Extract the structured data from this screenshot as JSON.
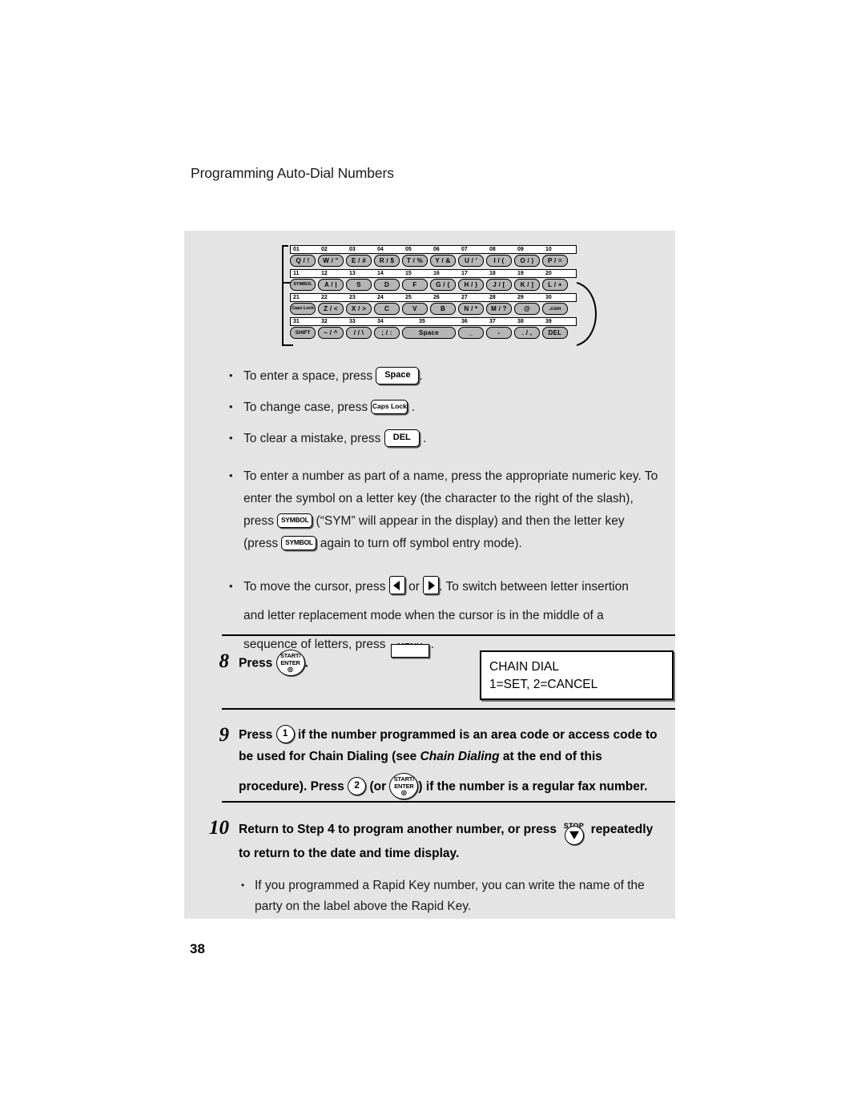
{
  "page": {
    "running_head": "Programming Auto-Dial Numbers",
    "page_number": "38"
  },
  "keyboard_figure": {
    "rows": [
      {
        "numbers": [
          "01",
          "02",
          "03",
          "04",
          "05",
          "06",
          "07",
          "08",
          "09",
          "10"
        ],
        "keys": [
          "Q / !",
          "W / \"",
          "E / #",
          "R / $",
          "T / %",
          "Y / &",
          "U / '",
          "I / (",
          "O / )",
          "P / ="
        ]
      },
      {
        "numbers": [
          "11",
          "12",
          "13",
          "14",
          "15",
          "16",
          "17",
          "18",
          "19",
          "20"
        ],
        "keys": [
          "SYMBOL",
          "A / |",
          "S",
          "D",
          "F",
          "G / {",
          "H / }",
          "J / [",
          "K / ]",
          "L / +"
        ]
      },
      {
        "numbers": [
          "21",
          "22",
          "23",
          "24",
          "25",
          "26",
          "27",
          "28",
          "29",
          "30"
        ],
        "keys": [
          "Caps Lock",
          "Z / <",
          "X / >",
          "C",
          "V",
          "B",
          "N / *",
          "M / ?",
          "@",
          ".com"
        ]
      },
      {
        "numbers": [
          "31",
          "32",
          "33",
          "34",
          "35",
          "36",
          "37",
          "38",
          "39"
        ],
        "keys": [
          "SHIFT",
          "~ / ^",
          "/ / \\",
          "; / :",
          "Space",
          "_",
          "-",
          ". / ,",
          "DEL"
        ]
      }
    ]
  },
  "bullets": {
    "space": {
      "pre": "To enter a space, press",
      "key": "Space",
      "post": "."
    },
    "case": {
      "pre": "To change case, press",
      "key": "Caps Lock",
      "post": "."
    },
    "clear": {
      "pre": "To clear a mistake, press",
      "key": "DEL",
      "post": "."
    },
    "symbol": {
      "line1": "To enter a number as part of a name, press the appropriate numeric key. To",
      "line2": "enter the symbol on a letter key (the character to the right of the slash),",
      "line3a": "press",
      "key1": "SYMBOL",
      "line3b": "(“SYM” will appear in the display) and then the letter key",
      "line4a": "(press",
      "key2": "SYMBOL",
      "line4b": "again to turn off symbol entry mode)."
    },
    "cursor": {
      "line1a": "To move the cursor, press",
      "arrow_left": "left-arrow",
      "or": "or",
      "arrow_right": "right-arrow",
      "line1b": ". To switch between letter insertion",
      "line2": "and letter replacement mode when the cursor is in the middle of a",
      "line3a": "sequence of letters, press",
      "menu_key": "MENU",
      "line3b": "."
    }
  },
  "steps": [
    {
      "number": "8",
      "pre": "Press",
      "button": {
        "line1": "START/",
        "line2": "ENTER"
      },
      "post": ".",
      "display": {
        "line1": "CHAIN DIAL",
        "line2": "1=SET, 2=CANCEL"
      }
    },
    {
      "number": "9",
      "t1": "Press",
      "digit1": "1",
      "t2": "if the number programmed is an area code or access code to",
      "t3": "be used for Chain Dialing (see",
      "t3_italic": "Chain Dialing",
      "t4": "at the end of this",
      "t5": "procedure). Press",
      "digit2": "2",
      "t6": "(or",
      "button": {
        "line1": "START/",
        "line2": "ENTER"
      },
      "t7": ") if the number is a regular fax number."
    },
    {
      "number": "10",
      "t1": "Return to Step 4 to program another number, or press",
      "stop_label": "STOP",
      "t2": "repeatedly",
      "t3": "to return to the date and time display.",
      "sub_bullet_line1": "If you programmed a Rapid Key number, you can write the name of the",
      "sub_bullet_line2": "party on the label above the Rapid Key."
    }
  ]
}
